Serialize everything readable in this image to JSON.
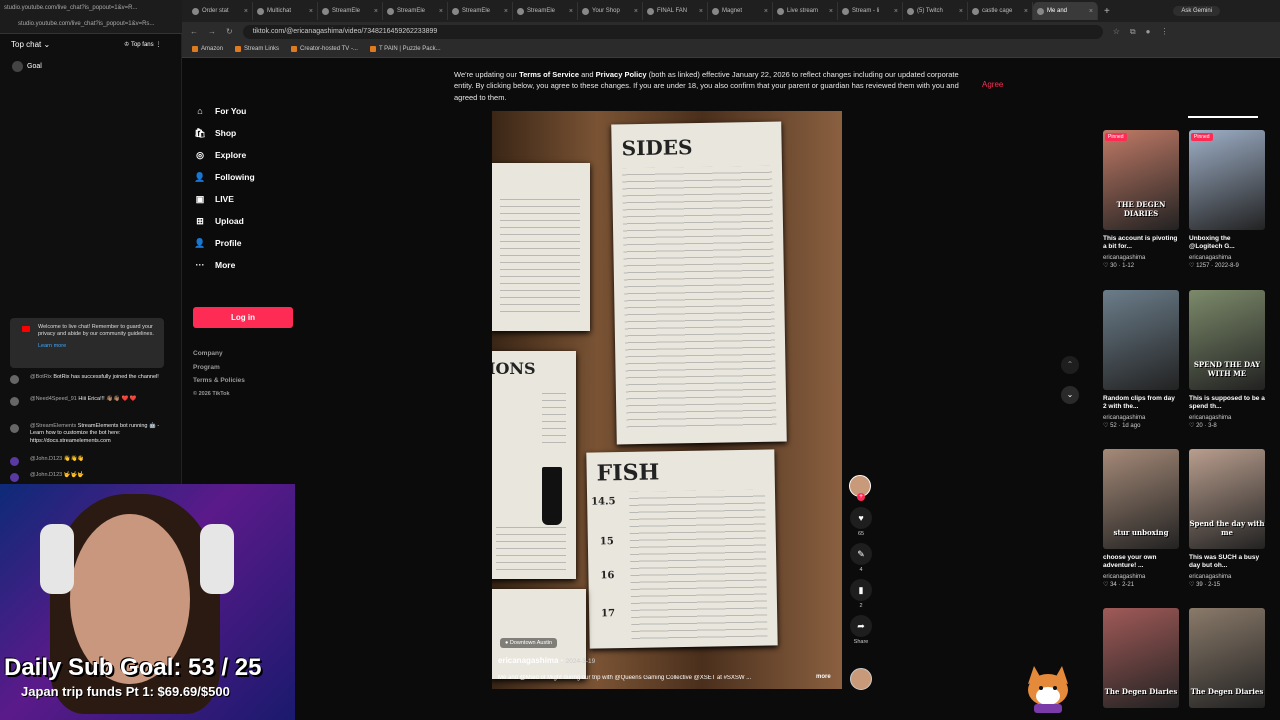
{
  "browser": {
    "tabs": [
      {
        "label": "Order stat",
        "active": false
      },
      {
        "label": "Multichat",
        "active": false
      },
      {
        "label": "StreamEle",
        "active": false
      },
      {
        "label": "StreamEle",
        "active": false
      },
      {
        "label": "StreamEle",
        "active": false
      },
      {
        "label": "StreamEle",
        "active": false
      },
      {
        "label": "Your Shop",
        "active": false
      },
      {
        "label": "FINAL FAN",
        "active": false
      },
      {
        "label": "Magnet",
        "active": false
      },
      {
        "label": "Live stream",
        "active": false
      },
      {
        "label": "Stream - li",
        "active": false
      },
      {
        "label": "(5) Twitch",
        "active": false
      },
      {
        "label": "castle cage",
        "active": false
      },
      {
        "label": "Me and",
        "active": true
      }
    ],
    "ask_label": "Ask Gemini",
    "url": "tiktok.com/@ericanagashima/video/7348216459262233899",
    "bookmarks": [
      "Amazon",
      "Stream Links",
      "Creator-hosted TV -...",
      "T PAIN | Puzzle Pack..."
    ]
  },
  "chat": {
    "popout_url": "studio.youtube.com/live_chat?is_popout=1&v=R...",
    "popout_url2": "studio.youtube.com/live_chat?is_popout=1&v=Rs...",
    "mode": "Top chat",
    "top_fans": "Top fans",
    "goal": "Goal",
    "welcome": "Welcome to live chat! Remember to guard your privacy and abide by our community guidelines.",
    "learn_more": "Learn more",
    "messages": [
      {
        "name": "@BotRix",
        "text": "BotRix has successfully joined the channel!"
      },
      {
        "name": "@Need4Speed_91",
        "text": "Hiii Erica!!! 👋🏽👋🏽 ❤️ ❤️"
      },
      {
        "name": "@StreamElements",
        "text": "StreamElements bot running 🤖 - Learn how to customize the bot here: https://docs.streamelements.com"
      },
      {
        "name": "@John.D123",
        "text": "👋👋👋"
      },
      {
        "name": "@John.D123",
        "text": "🤟🤟🤟"
      }
    ]
  },
  "overlay": {
    "sub_goal": "Daily Sub Goal: 53 / 25",
    "trip": "Japan trip funds Pt 1: $69.69/$500"
  },
  "terms": {
    "text_a": "We're updating our ",
    "link1": "Terms of Service",
    "text_b": " and ",
    "link2": "Privacy Policy",
    "text_c": " (both as linked) effective January 22, 2026 to reflect changes including our updated corporate entity. By clicking below, you agree to these changes. If you are under 18, you also confirm that your parent or guardian has reviewed them with you and agreed to them.",
    "agree": "Agree"
  },
  "tiktok_nav": {
    "items": [
      {
        "label": "For You",
        "icon": "home-icon"
      },
      {
        "label": "Shop",
        "icon": "shop-icon"
      },
      {
        "label": "Explore",
        "icon": "compass-icon"
      },
      {
        "label": "Following",
        "icon": "following-icon"
      },
      {
        "label": "LIVE",
        "icon": "live-icon"
      },
      {
        "label": "Upload",
        "icon": "upload-icon"
      },
      {
        "label": "Profile",
        "icon": "profile-icon"
      },
      {
        "label": "More",
        "icon": "more-icon"
      }
    ],
    "login": "Log in",
    "footer": [
      "Company",
      "Program",
      "Terms & Policies",
      "© 2026 TikTok"
    ]
  },
  "video": {
    "menu_headings": [
      "SIDES",
      "FISH",
      "IONS"
    ],
    "prices": [
      "14.5",
      "15",
      "16",
      "17"
    ],
    "location_tag": "Downtown Austin",
    "author": "ericanagashima",
    "date": "2024-3-19",
    "description": "Me and @Maid of Might during our trip with @Queens Gaming Collective @XSET at #SXSW ...",
    "more": "more",
    "likes": "65",
    "comments": "4",
    "saves": "2",
    "share": "Share"
  },
  "grid": [
    {
      "title": "This account is pivoting a bit for...",
      "user": "ericanagashima",
      "likes": "30",
      "date": "1-12",
      "pinned": "Pinned",
      "caption": "THE DEGEN DIARIES",
      "color": "#c07a66"
    },
    {
      "title": "Unboxing the @Logitech G...",
      "user": "ericanagashima",
      "likes": "1257",
      "date": "2022-8-9",
      "pinned": "Pinned",
      "caption": "",
      "color": "#9fb0c8"
    },
    {
      "title": "Random clips from day 2 with the...",
      "user": "ericanagashima",
      "likes": "52",
      "date": "1d ago",
      "pinned": "",
      "caption": "",
      "color": "#6b7d8a"
    },
    {
      "title": "This is supposed to be a spend th...",
      "user": "ericanagashima",
      "likes": "20",
      "date": "3-8",
      "pinned": "",
      "caption": "SPEND THE DAY WITH ME",
      "color": "#7c8a6a"
    },
    {
      "title": "choose your own adventure! ...",
      "user": "ericanagashima",
      "likes": "34",
      "date": "2-21",
      "pinned": "",
      "caption": "stur unboxing",
      "color": "#a58a78"
    },
    {
      "title": "This was SUCH a busy day but oh...",
      "user": "ericanagashima",
      "likes": "39",
      "date": "2-15",
      "pinned": "",
      "caption": "Spend the day with me",
      "color": "#b99e8e"
    },
    {
      "title": "",
      "user": "",
      "likes": "",
      "date": "",
      "pinned": "",
      "caption": "The Degen Diaries",
      "color": "#a05a58"
    },
    {
      "title": "",
      "user": "",
      "likes": "",
      "date": "",
      "pinned": "",
      "caption": "The Degen Diaries",
      "color": "#8a7a6a"
    }
  ],
  "colors": {
    "accent": "#fe2c55",
    "link": "#3ea6ff"
  }
}
